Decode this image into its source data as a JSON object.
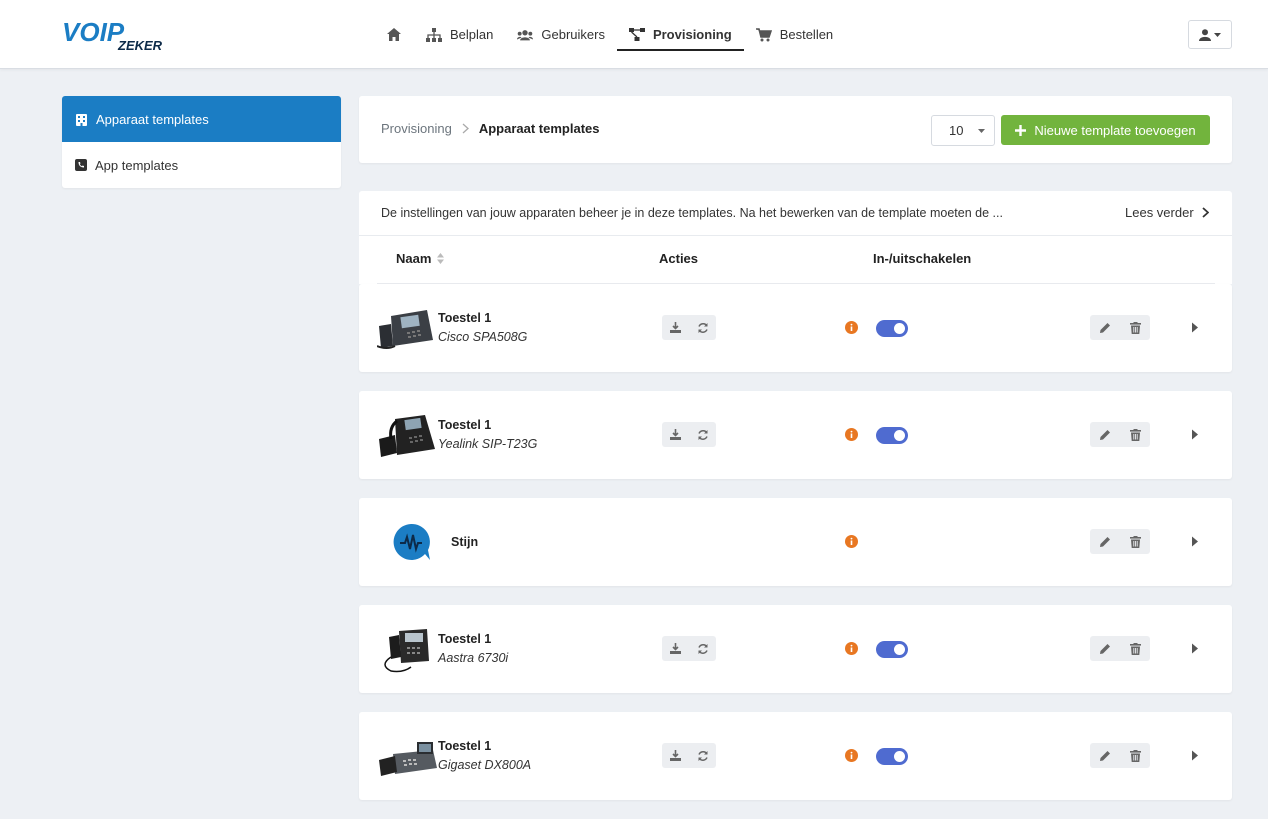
{
  "brand": {
    "logo_main": "VOIP",
    "logo_sub": "ZEKER",
    "accent": "#1b7dc4",
    "success": "#72b43d",
    "toggle_on": "#4f6bd0",
    "warning": "#e87722"
  },
  "nav": {
    "items": [
      {
        "label": "",
        "icon": "home-icon"
      },
      {
        "label": "Belplan",
        "icon": "sitemap-icon"
      },
      {
        "label": "Gebruikers",
        "icon": "users-icon"
      },
      {
        "label": "Provisioning",
        "icon": "network-icon",
        "active": true
      },
      {
        "label": "Bestellen",
        "icon": "cart-icon"
      }
    ],
    "user_menu_icon": "user-icon"
  },
  "sidebar": {
    "items": [
      {
        "label": "Apparaat templates",
        "icon": "building-icon",
        "active": true
      },
      {
        "label": "App templates",
        "icon": "phone-square-icon",
        "active": false
      }
    ]
  },
  "header": {
    "breadcrumb": [
      "Provisioning",
      "Apparaat templates"
    ],
    "page_size": "10",
    "add_button": "Nieuwe template toevoegen"
  },
  "info": {
    "text": "De instellingen van jouw apparaten beheer je in deze templates. Na het bewerken van de template moeten de ...",
    "read_more": "Lees verder"
  },
  "table": {
    "columns": [
      "Naam",
      "Acties",
      "In-/uitschakelen"
    ],
    "rows": [
      {
        "title": "Toestel 1",
        "model": "Cisco SPA508G",
        "device": "cisco",
        "enabled": true,
        "has_actions": true
      },
      {
        "title": "Toestel 1",
        "model": "Yealink SIP-T23G",
        "device": "yealink",
        "enabled": true,
        "has_actions": true
      },
      {
        "title": "Stijn",
        "model": "",
        "device": "app",
        "enabled": null,
        "has_actions": false
      },
      {
        "title": "Toestel 1",
        "model": "Aastra 6730i",
        "device": "aastra",
        "enabled": true,
        "has_actions": true
      },
      {
        "title": "Toestel 1",
        "model": "Gigaset DX800A",
        "device": "gigaset",
        "enabled": true,
        "has_actions": true
      }
    ]
  }
}
